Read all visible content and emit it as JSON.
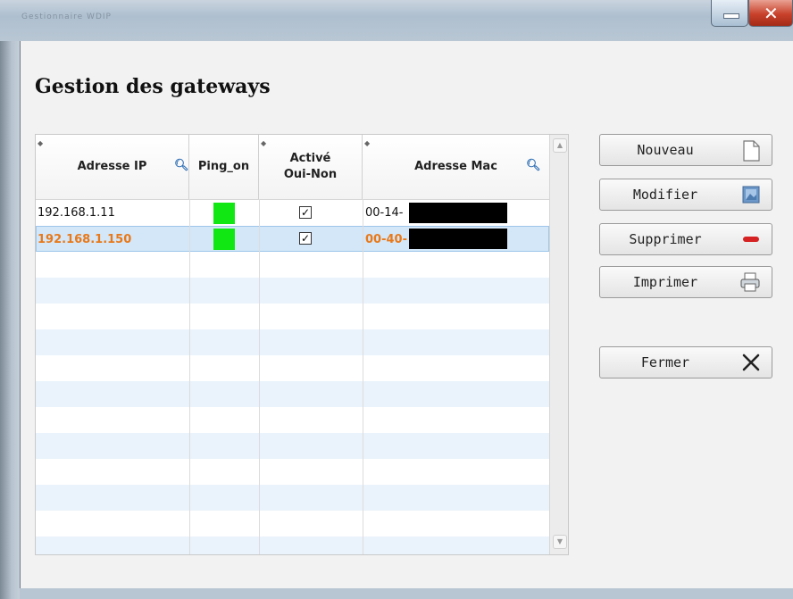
{
  "window": {
    "ghost_title": "Gestionnaire WDIP"
  },
  "dialog": {
    "title": "Gestion des gateways"
  },
  "table": {
    "columns": [
      "Adresse IP",
      "Ping_on",
      "Activé\nOui-Non",
      "Adresse Mac"
    ],
    "rows": [
      {
        "ip": "192.168.1.11",
        "ping_on": true,
        "active": true,
        "mac": "00-14-"
      },
      {
        "ip": "192.168.1.150",
        "ping_on": true,
        "active": true,
        "mac": "00-40-"
      }
    ],
    "selected_row": 2
  },
  "buttons": {
    "nouveau": "Nouveau",
    "modifier": "Modifier",
    "supprimer": "Supprimer",
    "imprimer": "Imprimer",
    "fermer": "Fermer"
  },
  "colors": {
    "selected_text": "#e8791a",
    "ping_ok": "#11e813",
    "row_alt": "#eaf3fb"
  }
}
